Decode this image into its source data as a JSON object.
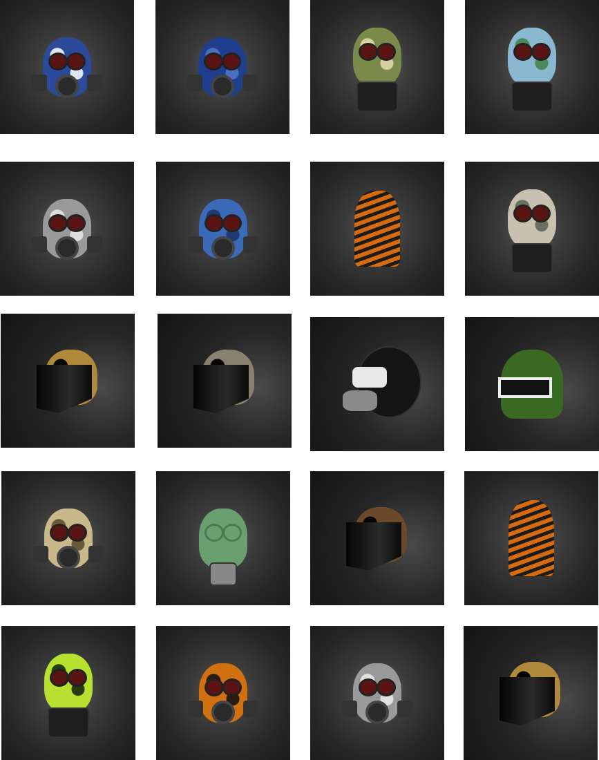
{
  "grid": {
    "items": [
      {
        "kind": "gas-mask",
        "color": "#2c4a9a",
        "accent": "#dfe6f0"
      },
      {
        "kind": "gas-mask",
        "color": "#1f3f8e",
        "accent": "#4a6fc0"
      },
      {
        "kind": "canister-mask",
        "color": "#7a8a4a",
        "accent": "#d8d0a0"
      },
      {
        "kind": "canister-mask",
        "color": "#8ab8d0",
        "accent": "#4a8a5a"
      },
      {
        "kind": "gas-mask",
        "color": "#9a9a9a",
        "accent": "#dddddd"
      },
      {
        "kind": "gas-mask",
        "color": "#3a6ab8",
        "accent": "#1e3a70"
      },
      {
        "kind": "balaclava",
        "color": "#d56a10",
        "accent": "#1b1b1b"
      },
      {
        "kind": "canister-mask",
        "color": "#c8c0b0",
        "accent": "#6a7060"
      },
      {
        "kind": "visor-helmet",
        "color": "#b08a3a",
        "accent": "#050505"
      },
      {
        "kind": "visor-helmet",
        "color": "#8a8070",
        "accent": "#050505"
      },
      {
        "kind": "pilot-helmet",
        "color": "#151515",
        "accent": "#e8e8e8"
      },
      {
        "kind": "green-helmet",
        "color": "#3a6a22",
        "accent": "#eeeeee"
      },
      {
        "kind": "gas-mask",
        "color": "#c8b88a",
        "accent": "#6a5a3a"
      },
      {
        "kind": "hose-mask",
        "color": "#6aa070",
        "accent": "#777777"
      },
      {
        "kind": "visor-helmet",
        "color": "#6a4a2a",
        "accent": "#050505"
      },
      {
        "kind": "balaclava",
        "color": "#d56a10",
        "accent": "#1b1b1b"
      },
      {
        "kind": "canister-mask",
        "color": "#b8e030",
        "accent": "#2a3a10"
      },
      {
        "kind": "gas-mask",
        "color": "#d07010",
        "accent": "#2a1a10"
      },
      {
        "kind": "gas-mask",
        "color": "#9a9a9a",
        "accent": "#e0e0e0"
      },
      {
        "kind": "visor-helmet",
        "color": "#b08a3a",
        "accent": "#050505"
      }
    ]
  }
}
